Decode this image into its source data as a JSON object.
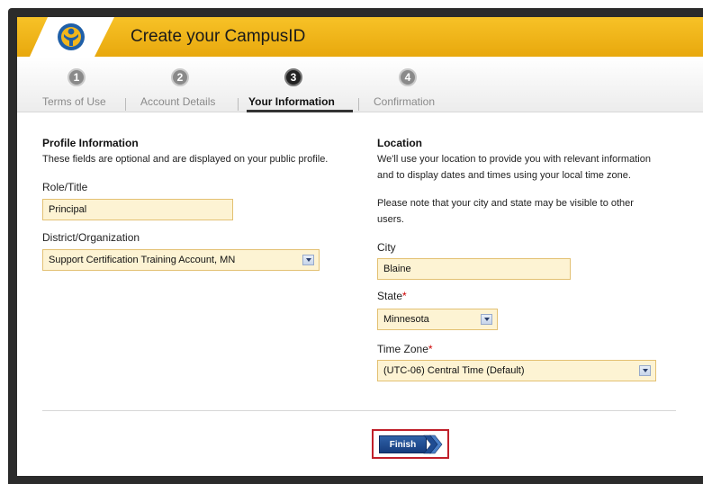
{
  "header": {
    "title": "Create your CampusID",
    "logo_icon": "campus-person-logo-icon"
  },
  "steps": [
    {
      "number": "1",
      "label": "Terms of Use",
      "active": false
    },
    {
      "number": "2",
      "label": "Account Details",
      "active": false
    },
    {
      "number": "3",
      "label": "Your Information",
      "active": true
    },
    {
      "number": "4",
      "label": "Confirmation",
      "active": false
    }
  ],
  "profile": {
    "title": "Profile Information",
    "description": "These fields are optional and are displayed on your public profile.",
    "role_label": "Role/Title",
    "role_value": "Principal",
    "district_label": "District/Organization",
    "district_value": "Support Certification Training Account, MN"
  },
  "location": {
    "title": "Location",
    "description_line1": "We'll use your location to provide you with relevant information",
    "description_line2": "and to display dates and times using your local time zone.",
    "note_line1": "Please note that your city and state may be visible to other",
    "note_line2": "users.",
    "city_label": "City",
    "city_value": "Blaine",
    "state_label": "State",
    "state_required": "*",
    "state_value": "Minnesota",
    "timezone_label": "Time Zone",
    "timezone_required": "*",
    "timezone_value": "(UTC-06) Central Time (Default)"
  },
  "actions": {
    "finish_label": "Finish"
  },
  "colors": {
    "header_gold": "#f2b61c",
    "field_bg": "#fdf3d3",
    "button_blue": "#1f4c92",
    "highlight_red": "#c0202a"
  }
}
